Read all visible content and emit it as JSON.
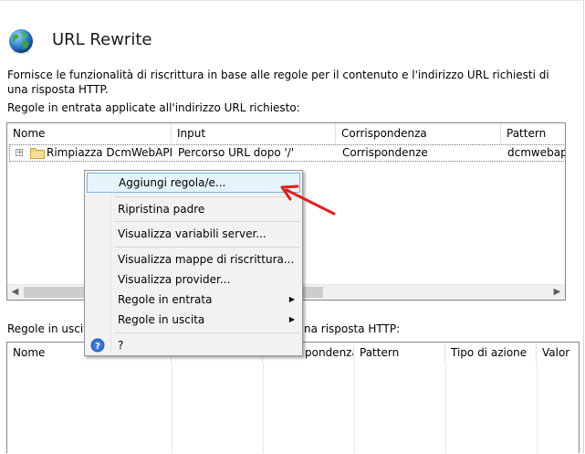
{
  "page": {
    "title": "URL Rewrite",
    "description": "Fornisce le funzionalità di riscrittura in base alle regole per il contenuto e l'indirizzo URL richiesti di una risposta HTTP.",
    "inbound_label": "Regole in entrata applicate all'indirizzo URL richiesto:",
    "outbound_label_left": "Regole in uscita",
    "outbound_label_right": "na risposta HTTP:"
  },
  "inbound_table": {
    "headers": [
      "Nome",
      "Input",
      "Corrispondenza",
      "Pattern"
    ],
    "rows": [
      {
        "name": "Rimpiazza DcmWebAPI ...",
        "input": "Percorso URL dopo '/'",
        "match": "Corrispondenze",
        "pattern": "dcmwebapi("
      }
    ]
  },
  "outbound_table": {
    "headers": [
      "Nome",
      "pondenza",
      "Pattern",
      "Tipo di azione",
      "Valor"
    ]
  },
  "context_menu": {
    "items": [
      {
        "label": "Aggiungi regola/e..."
      },
      {
        "label": "Ripristina padre"
      },
      {
        "label": "Visualizza variabili server..."
      },
      {
        "label": "Visualizza mappe di riscrittura..."
      },
      {
        "label": "Visualizza provider..."
      },
      {
        "label": "Regole in entrata"
      },
      {
        "label": "Regole in uscita"
      },
      {
        "label": "?"
      }
    ]
  },
  "icons": {
    "title": "globe-icon",
    "row": "folder-icon",
    "help": "help-icon"
  },
  "colors": {
    "highlight_bg": "#e5f3fb",
    "highlight_border": "#7eb4ea",
    "annotation_arrow": "#e0201c"
  }
}
